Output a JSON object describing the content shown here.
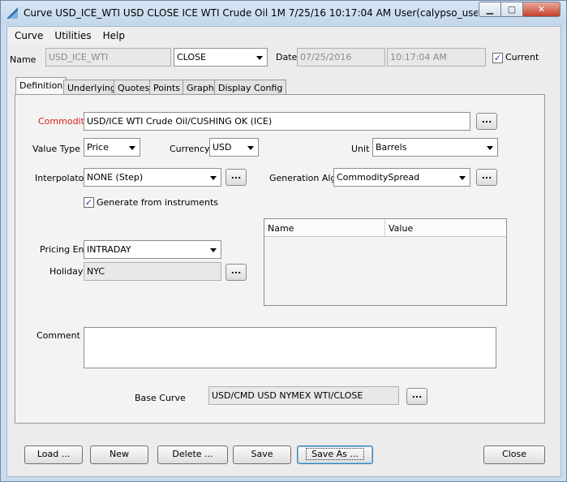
{
  "window": {
    "title": "Curve  USD_ICE_WTI USD CLOSE ICE WTI Crude Oil 1M 7/25/16 10:17:04 AM User(calypso_user)(PE INT...",
    "minimize_glyph": "▁",
    "maximize_glyph": "▢",
    "close_glyph": "✕"
  },
  "menu": [
    "Curve",
    "Utilities",
    "Help"
  ],
  "header": {
    "name_label": "Name",
    "name_value": "USD_ICE_WTI",
    "close_value": "CLOSE",
    "date_label": "Date",
    "date_value": "07/25/2016",
    "time_value": "10:17:04 AM",
    "current_label": "Current",
    "current_checked": "✓"
  },
  "tabs": [
    "Definition",
    "Underlying",
    "Quotes",
    "Points",
    "Graph",
    "Display Config"
  ],
  "definition": {
    "commodity_label": "Commodity",
    "commodity_value": "USD/ICE WTI Crude Oil/CUSHING OK (ICE)",
    "value_type_label": "Value Type",
    "value_type_value": "Price",
    "currency_label": "Currency",
    "currency_value": "USD",
    "unit_label": "Unit",
    "unit_value": "Barrels",
    "interpolator_label": "Interpolator",
    "interpolator_value": "NONE (Step)",
    "generation_label": "Generation Alg.",
    "generation_value": "CommoditySpread",
    "generate_label": "Generate from instruments",
    "generate_checked": "✓",
    "pricing_env_label": "Pricing Env",
    "pricing_env_value": "INTRADAY",
    "holidays_label": "Holidays",
    "holidays_value": "NYC",
    "table_columns": [
      "Name",
      "Value"
    ],
    "comment_label": "Comment",
    "base_curve_label": "Base Curve",
    "base_curve_value": "USD/CMD USD NYMEX WTI/CLOSE",
    "ellipsis": "..."
  },
  "buttons": {
    "load": "Load ...",
    "new": "New",
    "delete": "Delete ...",
    "save": "Save",
    "save_as": "Save As ...",
    "close": "Close"
  },
  "colors": {
    "required_label": "#e0201c",
    "window_frame": "#c9dcef"
  }
}
